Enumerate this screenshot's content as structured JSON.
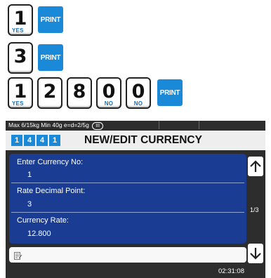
{
  "keys": {
    "row1": [
      {
        "digit": "1",
        "sub": "YES"
      }
    ],
    "row2": [
      {
        "digit": "3",
        "sub": ""
      }
    ],
    "row3": [
      {
        "digit": "1",
        "sub": "YES"
      },
      {
        "digit": "2",
        "sub": ""
      },
      {
        "digit": "8",
        "sub": ""
      },
      {
        "digit": "0",
        "sub": "NO"
      },
      {
        "digit": "0",
        "sub": "NO"
      }
    ],
    "print_label": "PRINT"
  },
  "display": {
    "status_text": "Max 6/15kg Min 40g e=d=2/5g",
    "status_badge": "III",
    "menu_code": [
      "1",
      "4",
      "4",
      "1"
    ],
    "title": "NEW/EDIT CURRENCY",
    "fields": [
      {
        "label": "Enter Currency No:",
        "value": "1"
      },
      {
        "label": "Rate Decimal Point:",
        "value": "3"
      },
      {
        "label": "Currency Rate:",
        "value": "12.800"
      }
    ],
    "page_indicator": "1/3",
    "clock": "02:31:08",
    "icons": {
      "up": "arrow-up-icon",
      "down": "arrow-down-icon",
      "edit": "edit-input-icon"
    }
  }
}
